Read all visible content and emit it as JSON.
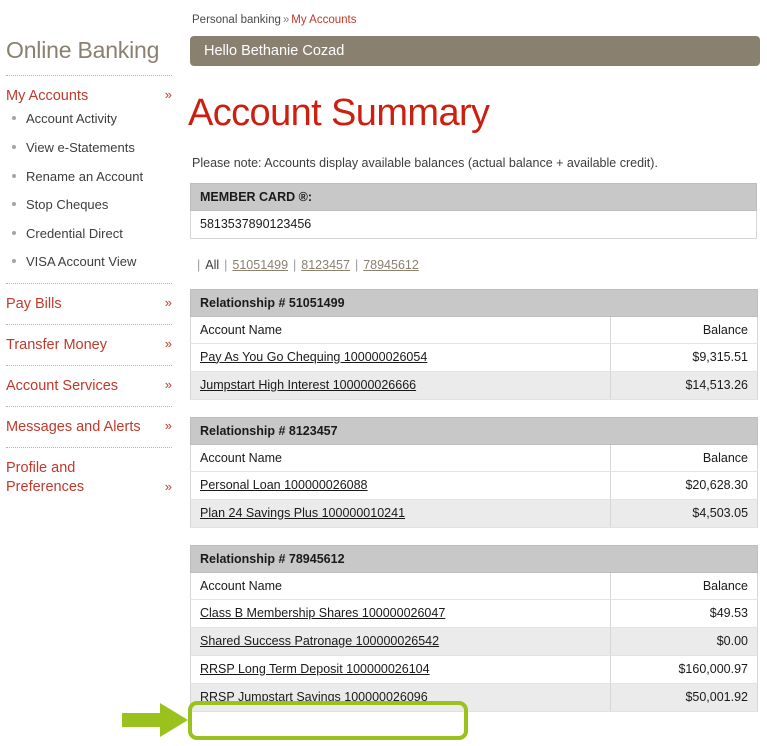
{
  "sidebar": {
    "brand": "Online Banking",
    "groups": [
      {
        "label": "My Accounts",
        "chevron": "»",
        "items": [
          {
            "label": "Account Activity"
          },
          {
            "label": "View e-Statements"
          },
          {
            "label": "Rename an Account"
          },
          {
            "label": "Stop Cheques"
          },
          {
            "label": "Credential Direct"
          },
          {
            "label": "VISA Account View"
          }
        ]
      },
      {
        "label": "Pay Bills",
        "chevron": "»",
        "items": []
      },
      {
        "label": "Transfer Money",
        "chevron": "»",
        "items": []
      },
      {
        "label": "Account Services",
        "chevron": "»",
        "items": []
      },
      {
        "label": "Messages and Alerts",
        "chevron": "»",
        "items": []
      },
      {
        "label": "Profile and Preferences",
        "chevron": "»",
        "items": []
      }
    ]
  },
  "breadcrumb": {
    "root": "Personal banking",
    "separator": "»",
    "current": "My Accounts"
  },
  "greeting": "Hello Bethanie Cozad",
  "page_title": "Account Summary",
  "note": "Please note: Accounts display available balances (actual balance + available credit).",
  "member_card": {
    "header": "MEMBER CARD ®:",
    "number": "5813537890123456"
  },
  "filters": {
    "all_label": "All",
    "links": [
      "51051499",
      "8123457",
      "78945612"
    ]
  },
  "relationships": [
    {
      "header": "Relationship # 51051499",
      "col_account": "Account Name",
      "col_balance": "Balance",
      "rows": [
        {
          "account": "Pay As You Go Chequing 100000026054",
          "balance": "$9,315.51"
        },
        {
          "account": "Jumpstart High Interest 100000026666",
          "balance": "$14,513.26"
        }
      ]
    },
    {
      "header": "Relationship # 8123457",
      "col_account": "Account Name",
      "col_balance": "Balance",
      "rows": [
        {
          "account": "Personal Loan 100000026088",
          "balance": "$20,628.30"
        },
        {
          "account": "Plan 24 Savings Plus 100000010241",
          "balance": "$4,503.05"
        }
      ]
    },
    {
      "header": "Relationship # 78945612",
      "col_account": "Account Name",
      "col_balance": "Balance",
      "rows": [
        {
          "account": "Class B Membership Shares 100000026047",
          "balance": "$49.53"
        },
        {
          "account": "Shared Success Patronage 100000026542",
          "balance": "$0.00"
        },
        {
          "account": "RRSP Long Term Deposit 100000026104",
          "balance": "$160,000.97"
        },
        {
          "account": "RRSP Jumpstart Savings 100000026096",
          "balance": "$50,001.92"
        }
      ]
    }
  ],
  "annotation": {
    "color": "#9ac21c",
    "target_account": "RRSP Jumpstart Savings 100000026096"
  },
  "colors": {
    "brand_taupe": "#8a8070",
    "accent_red": "#c0392b",
    "title_red": "#cc1f10",
    "table_header_grey": "#c8c8c8",
    "row_stripe_grey": "#ebebeb",
    "annotation_green": "#9ac21c"
  }
}
